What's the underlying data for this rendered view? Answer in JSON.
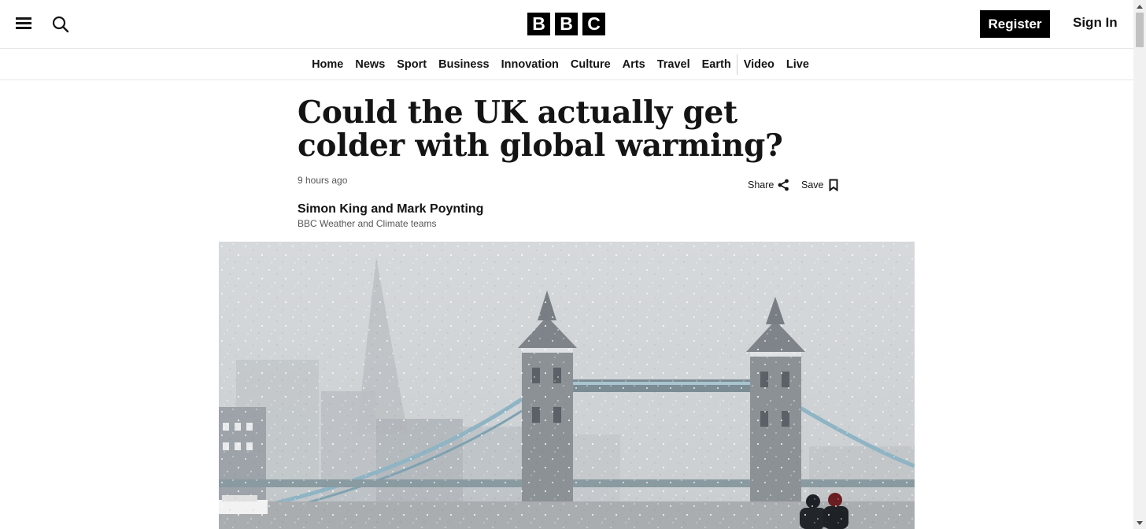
{
  "header": {
    "logo_letters": [
      "B",
      "B",
      "C"
    ],
    "register_label": "Register",
    "signin_label": "Sign In"
  },
  "nav": {
    "items": [
      "Home",
      "News",
      "Sport",
      "Business",
      "Innovation",
      "Culture",
      "Arts",
      "Travel",
      "Earth",
      "Video",
      "Live"
    ]
  },
  "article": {
    "headline": "Could the UK actually get colder with global warming?",
    "timestamp": "9 hours ago",
    "share_label": "Share",
    "save_label": "Save",
    "author": "Simon King and Mark Poynting",
    "author_role": "BBC Weather and Climate teams"
  },
  "colors": {
    "text": "#141414",
    "secondary_text": "#545658",
    "logo_bg": "#000000",
    "register_bg": "#000000"
  },
  "icons": [
    "menu-icon",
    "search-icon",
    "share-icon",
    "bookmark-icon",
    "scroll-up-icon",
    "scroll-down-icon"
  ]
}
